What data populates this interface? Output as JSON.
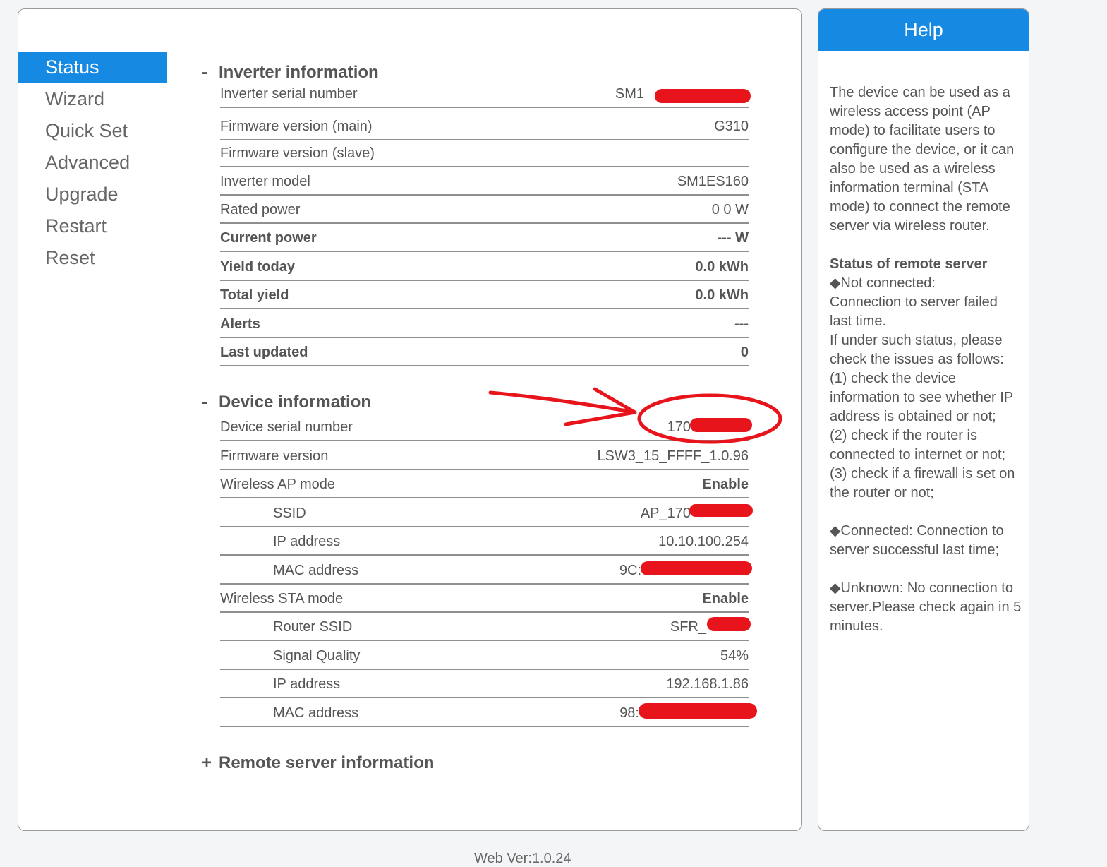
{
  "sidebar": {
    "items": [
      {
        "label": "Status",
        "active": true
      },
      {
        "label": "Wizard"
      },
      {
        "label": "Quick Set"
      },
      {
        "label": "Advanced"
      },
      {
        "label": "Upgrade"
      },
      {
        "label": "Restart"
      },
      {
        "label": "Reset"
      }
    ]
  },
  "inverter": {
    "sign": "-",
    "title": "Inverter information",
    "rows": [
      {
        "label": "Inverter serial number",
        "value": "SM1"
      },
      {
        "label": "Firmware version (main)",
        "value": "G310"
      },
      {
        "label": "Firmware version (slave)",
        "value": ""
      },
      {
        "label": "Inverter model",
        "value": "SM1ES160"
      },
      {
        "label": "Rated power",
        "value": "0 0 W"
      },
      {
        "label": "Current power",
        "value": "--- W"
      },
      {
        "label": "Yield today",
        "value": "0.0 kWh"
      },
      {
        "label": "Total yield",
        "value": "0.0 kWh"
      },
      {
        "label": "Alerts",
        "value": "---"
      },
      {
        "label": "Last updated",
        "value": "0"
      }
    ]
  },
  "device": {
    "sign": "-",
    "title": "Device information",
    "rows": [
      {
        "label": "Device serial number",
        "value": "170"
      },
      {
        "label": "Firmware version",
        "value": "LSW3_15_FFFF_1.0.96"
      },
      {
        "label": "Wireless AP mode",
        "value": "Enable"
      },
      {
        "label": "SSID",
        "value": "AP_170"
      },
      {
        "label": "IP address",
        "value": "10.10.100.254"
      },
      {
        "label": "MAC address",
        "value": "9C:"
      },
      {
        "label": "Wireless STA mode",
        "value": "Enable"
      },
      {
        "label": "Router SSID",
        "value": "SFR_"
      },
      {
        "label": "Signal Quality",
        "value": "54%"
      },
      {
        "label": "IP address",
        "value": "192.168.1.86"
      },
      {
        "label": "MAC address",
        "value": "98:"
      }
    ]
  },
  "remote": {
    "sign": "+",
    "title": "Remote server information"
  },
  "help": {
    "title": "Help",
    "intro": "The device can be used as a wireless access point (AP mode) to facilitate users to configure the device, or it can also be used as a wireless information terminal (STA mode) to connect the remote server via wireless router.",
    "status_heading": "Status of remote server",
    "not_connected_title": "◆Not connected:",
    "lines": [
      "Connection to server failed last time.",
      "If under such status, please check the issues as follows:",
      "(1) check the device information to see whether IP address is obtained or not;",
      "(2) check if the router is connected to internet or not;",
      "(3) check if a firewall is set on the router or not;"
    ],
    "connected": "◆Connected: Connection to server successful last time;",
    "unknown": "◆Unknown: No connection to server.Please check again in 5 minutes."
  },
  "footer": {
    "version": "Web Ver:1.0.24"
  },
  "colors": {
    "accent": "#168ae2",
    "annotation": "#e8141c"
  }
}
